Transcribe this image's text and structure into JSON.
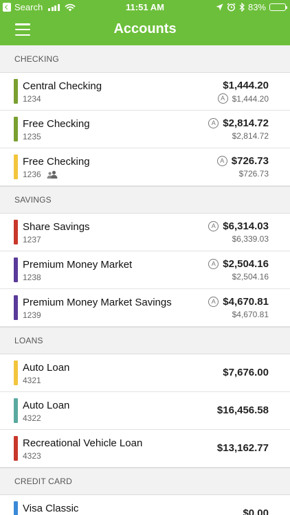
{
  "status_bar": {
    "back_app": "Search",
    "time": "11:51 AM",
    "battery": "83%",
    "battery_level": 0.83
  },
  "nav": {
    "title": "Accounts"
  },
  "sections": [
    {
      "title": "CHECKING",
      "accounts": [
        {
          "name": "Central Checking",
          "number": "1234",
          "balance": "$1,444.20",
          "available": "$1,444.20",
          "badge_position": "available",
          "shared": false,
          "color": "#7aa030"
        },
        {
          "name": "Free Checking",
          "number": "1235",
          "balance": "$2,814.72",
          "available": "$2,814.72",
          "badge_position": "balance",
          "shared": false,
          "color": "#7aa030"
        },
        {
          "name": "Free Checking",
          "number": "1236",
          "balance": "$726.73",
          "available": "$726.73",
          "badge_position": "balance",
          "shared": true,
          "color": "#f2c53d"
        }
      ]
    },
    {
      "title": "SAVINGS",
      "accounts": [
        {
          "name": "Share Savings",
          "number": "1237",
          "balance": "$6,314.03",
          "available": "$6,339.03",
          "badge_position": "balance",
          "shared": false,
          "color": "#c8382b"
        },
        {
          "name": "Premium Money Market",
          "number": "1238",
          "balance": "$2,504.16",
          "available": "$2,504.16",
          "badge_position": "balance",
          "shared": false,
          "color": "#5a3a9a"
        },
        {
          "name": "Premium Money Market Savings",
          "number": "1239",
          "balance": "$4,670.81",
          "available": "$4,670.81",
          "badge_position": "balance",
          "shared": false,
          "color": "#5a3a9a"
        }
      ]
    },
    {
      "title": "LOANS",
      "accounts": [
        {
          "name": "Auto Loan",
          "number": "4321",
          "balance": "$7,676.00",
          "available": "",
          "badge_position": "none",
          "shared": false,
          "color": "#f2c53d"
        },
        {
          "name": "Auto Loan",
          "number": "4322",
          "balance": "$16,456.58",
          "available": "",
          "badge_position": "none",
          "shared": false,
          "color": "#5aa9a0"
        },
        {
          "name": "Recreational Vehicle Loan",
          "number": "4323",
          "balance": "$13,162.77",
          "available": "",
          "badge_position": "none",
          "shared": false,
          "color": "#c8382b"
        }
      ]
    },
    {
      "title": "CREDIT CARD",
      "accounts": [
        {
          "name": "Visa Classic",
          "number": "",
          "balance": "$0.00",
          "available": "",
          "badge_position": "none",
          "shared": false,
          "color": "#3a8ad8"
        }
      ]
    }
  ],
  "badge_letter": "A",
  "icons": {
    "back": "back-chevron-icon",
    "menu": "hamburger-menu-icon",
    "available": "a-circle-badge-icon",
    "shared": "people-icon"
  }
}
